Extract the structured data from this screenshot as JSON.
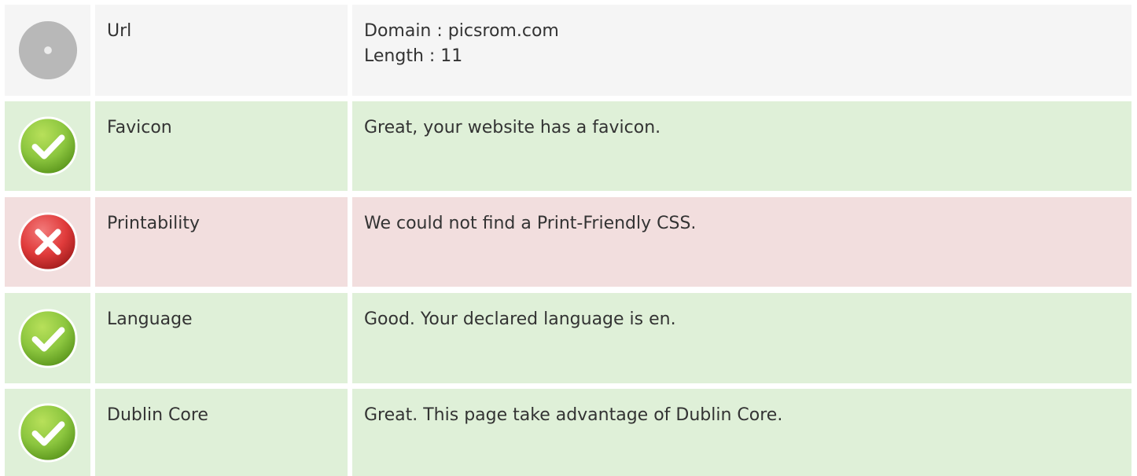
{
  "colors": {
    "neutral_row": "#f5f5f5",
    "pass_row": "#dff0d8",
    "fail_row": "#f2dede",
    "pass_icon": "#7cb82f",
    "fail_icon": "#d9363a",
    "neutral_icon": "#b8b8b8"
  },
  "rows": {
    "url": {
      "status": "neutral",
      "icon": "neutral-circle-icon",
      "label": "Url",
      "lines": [
        "Domain : picsrom.com",
        "Length : 11"
      ]
    },
    "favicon": {
      "status": "pass",
      "icon": "check-circle-icon",
      "label": "Favicon",
      "value": "Great, your website has a favicon."
    },
    "printability": {
      "status": "fail",
      "icon": "error-circle-icon",
      "label": "Printability",
      "value": "We could not find a Print-Friendly CSS."
    },
    "language": {
      "status": "pass",
      "icon": "check-circle-icon",
      "label": "Language",
      "value": "Good. Your declared language is en."
    },
    "dublin_core": {
      "status": "pass",
      "icon": "check-circle-icon",
      "label": "Dublin Core",
      "value": "Great. This page take advantage of Dublin Core."
    }
  }
}
